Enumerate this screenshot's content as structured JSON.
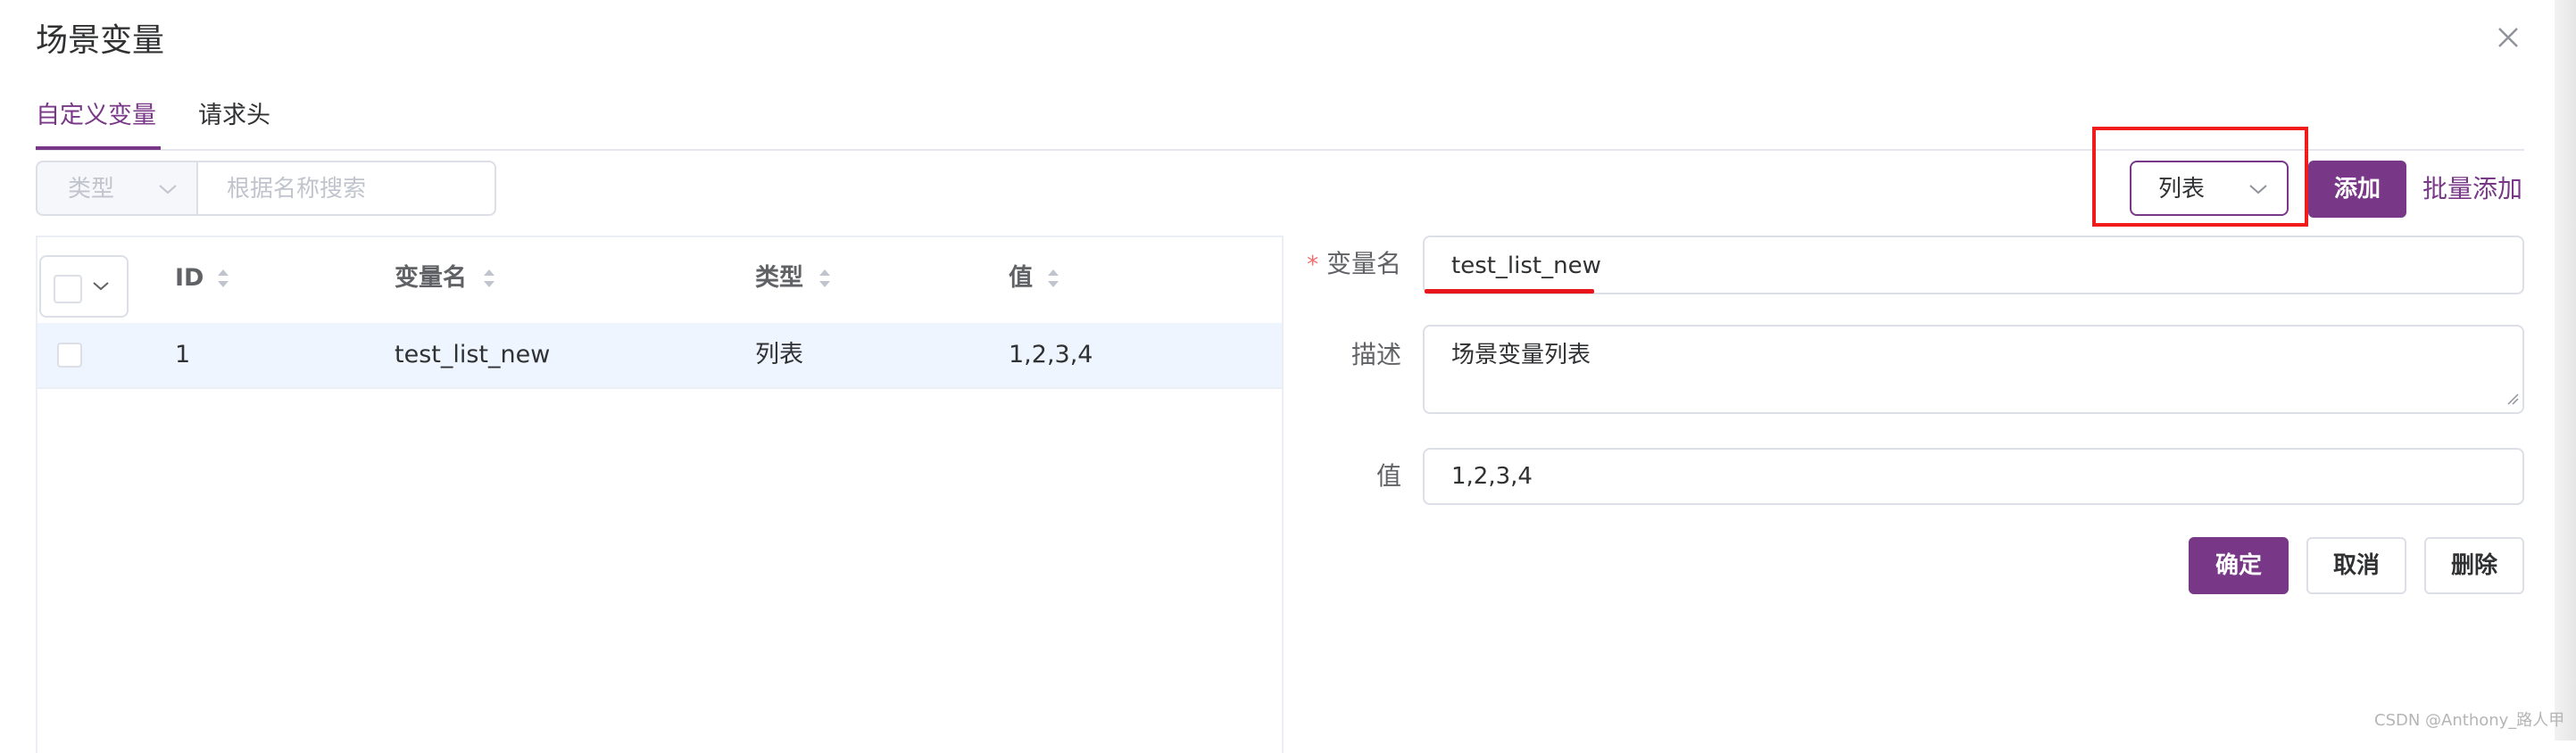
{
  "dialog": {
    "title": "场景变量",
    "close_icon": "close-icon"
  },
  "tabs": [
    {
      "label": "自定义变量",
      "active": true
    },
    {
      "label": "请求头",
      "active": false
    }
  ],
  "filter": {
    "type_placeholder": "类型",
    "search_placeholder": "根据名称搜索"
  },
  "toolbar": {
    "type_select_value": "列表",
    "add_label": "添加",
    "batch_add_label": "批量添加"
  },
  "table": {
    "columns": [
      "ID",
      "变量名",
      "类型",
      "值"
    ],
    "rows": [
      {
        "id": "1",
        "name": "test_list_new",
        "type": "列表",
        "value": "1,2,3,4",
        "selected": false
      }
    ]
  },
  "form": {
    "name_label": "变量名",
    "name_required": "*",
    "name_value": "test_list_new",
    "desc_label": "描述",
    "desc_value": "场景变量列表",
    "value_label": "值",
    "value_value": "1,2,3,4",
    "confirm_label": "确定",
    "cancel_label": "取消",
    "delete_label": "删除"
  },
  "colors": {
    "primary": "#783887",
    "highlight_red": "#f01c1c",
    "row_highlight": "#eef5fe"
  },
  "watermark": "CSDN @Anthony_路人甲"
}
